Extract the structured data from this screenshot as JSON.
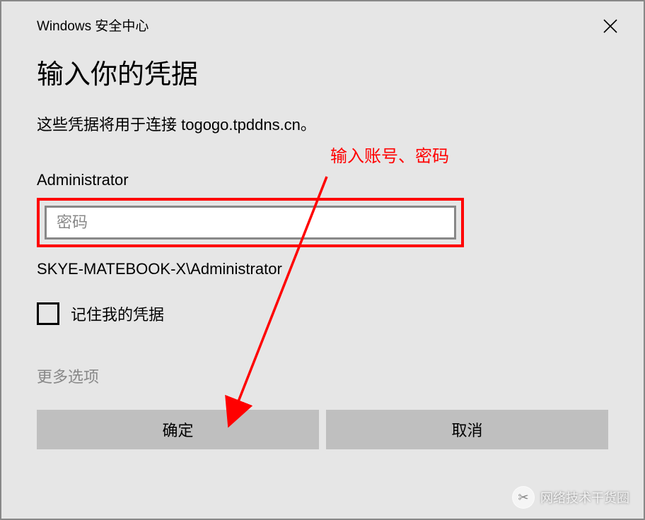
{
  "titlebar": {
    "title": "Windows 安全中心"
  },
  "dialog": {
    "heading": "输入你的凭据",
    "description": "这些凭据将用于连接 togogo.tpddns.cn。",
    "username_label": "Administrator",
    "password_placeholder": "密码",
    "domain_user": "SKYE-MATEBOOK-X\\Administrator",
    "remember_label": "记住我的凭据",
    "more_options": "更多选项",
    "ok_button": "确定",
    "cancel_button": "取消"
  },
  "annotation": {
    "text": "输入账号、密码",
    "color": "#ff0000"
  },
  "watermark": {
    "text": "网络技术干货圈"
  }
}
